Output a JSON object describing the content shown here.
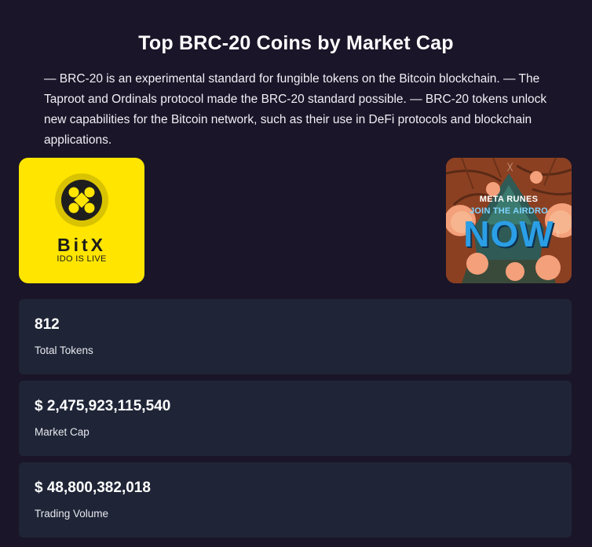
{
  "header": {
    "title": "Top BRC-20 Coins by Market Cap",
    "description": "— BRC-20 is an experimental standard for fungible tokens on the Bitcoin blockchain. — The Taproot and Ordinals protocol made the BRC-20 standard possible. — BRC-20 tokens unlock new capabilities for the Bitcoin network, such as their use in DeFi protocols and blockchain applications."
  },
  "banners": {
    "left": {
      "brand": "BitX",
      "tagline": "IDO IS LIVE",
      "background": "#ffe500"
    },
    "right": {
      "brand": "META RUNES",
      "line1": "JOIN THE AIRDRO",
      "line2": "NOW"
    }
  },
  "stats": [
    {
      "value": "812",
      "label": "Total Tokens"
    },
    {
      "value": "$ 2,475,923,115,540",
      "label": "Market Cap"
    },
    {
      "value": "$ 48,800,382,018",
      "label": "Trading Volume"
    }
  ],
  "colors": {
    "page_background": "#1a1528",
    "card_background": "#1f2537",
    "bitx_yellow": "#ffe500",
    "runes_blue": "#2b9fe6"
  }
}
